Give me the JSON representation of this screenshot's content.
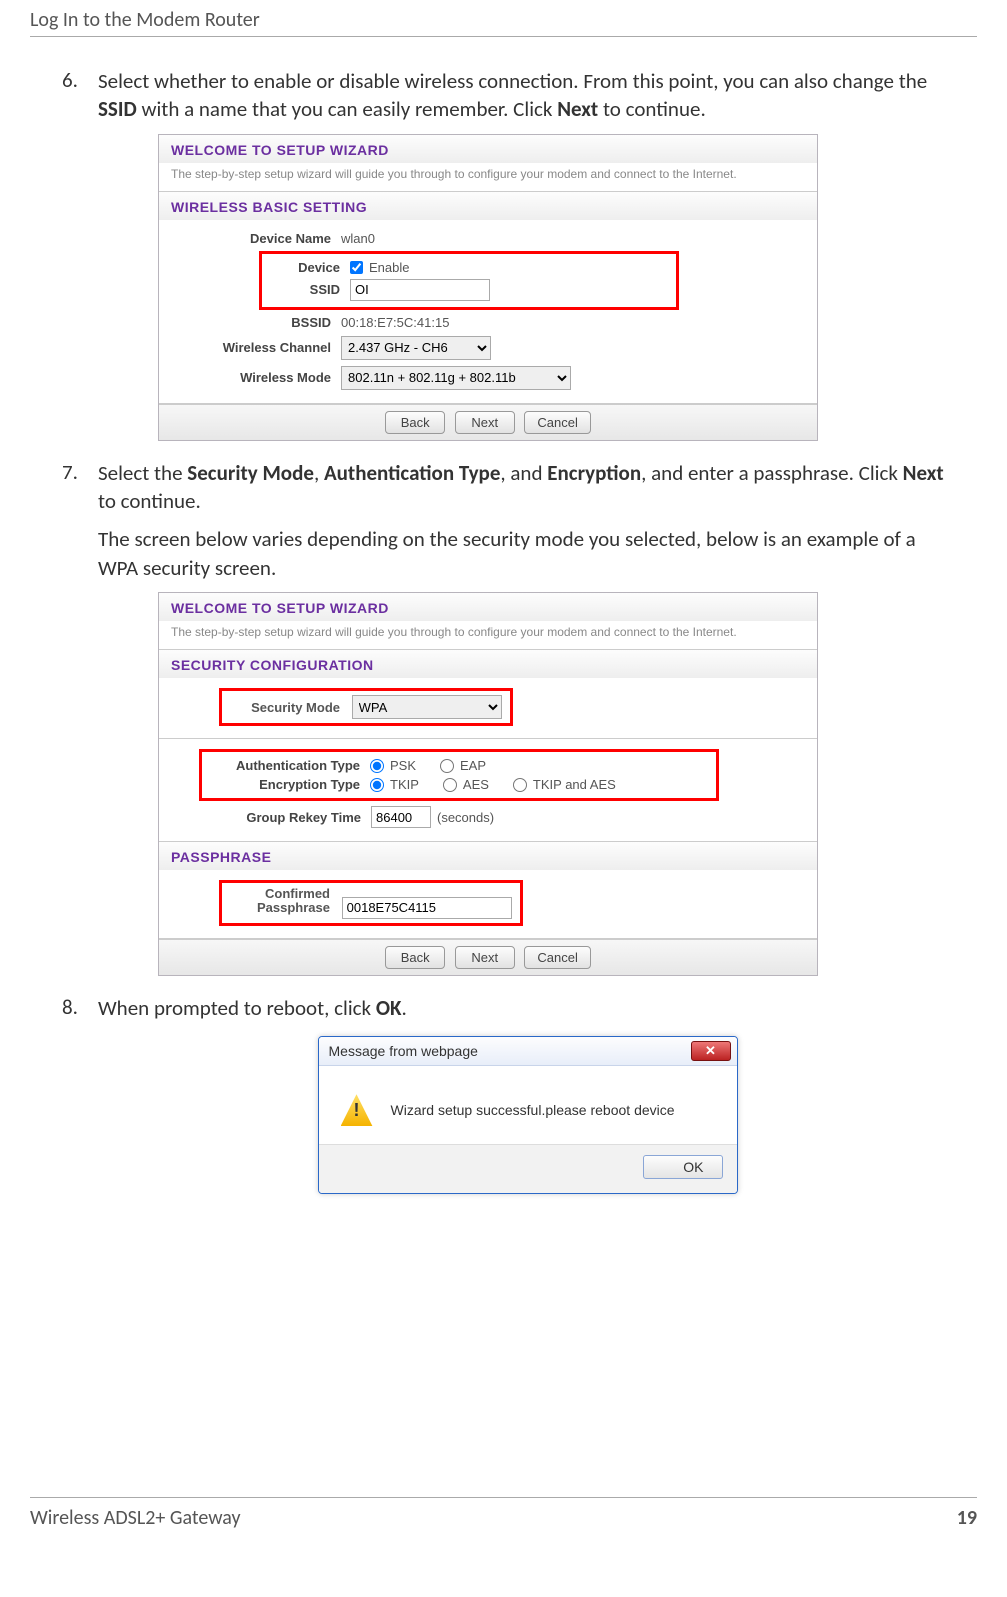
{
  "header": {
    "title": "Log In to the Modem Router"
  },
  "steps": {
    "s6": {
      "num": "6.",
      "text_pre": "Select whether to enable or disable wireless connection. From this point, you can also change the ",
      "ssid": "SSID",
      "text_mid": " with a name that you can easily remember. Click ",
      "next": "Next",
      "text_post": " to continue."
    },
    "s7": {
      "num": "7.",
      "l1_pre": "Select the ",
      "secmode": "Security Mode",
      "sep1": ", ",
      "authtype": "Authentication Type",
      "sep2": ", and ",
      "enc": "Encryption",
      "l1_mid": ", and enter a passphrase. Click ",
      "next": "Next",
      "l1_post": " to continue.",
      "l2": "The screen below varies depending on the security mode you selected, below is an example of a WPA security screen."
    },
    "s8": {
      "num": "8.",
      "pre": "When prompted to reboot, click ",
      "ok": "OK",
      "post": "."
    }
  },
  "wizard_title": "WELCOME TO SETUP WIZARD",
  "wizard_desc": "The step-by-step setup wizard will guide you through to configure your modem and connect to the Internet.",
  "wiz1": {
    "sec_head": "WIRELESS BASIC SETTING",
    "rows": {
      "devname_lbl": "Device Name",
      "devname_val": "wlan0",
      "device_lbl": "Device",
      "device_chk": "Enable",
      "ssid_lbl": "SSID",
      "ssid_val": "OI",
      "bssid_lbl": "BSSID",
      "bssid_val": "00:18:E7:5C:41:15",
      "chan_lbl": "Wireless Channel",
      "chan_val": "2.437 GHz - CH6",
      "mode_lbl": "Wireless Mode",
      "mode_val": "802.11n + 802.11g + 802.11b"
    }
  },
  "wiz2": {
    "sec1_head": "SECURITY CONFIGURATION",
    "rows": {
      "secmode_lbl": "Security Mode",
      "secmode_val": "WPA",
      "auth_lbl": "Authentication Type",
      "auth_psk": "PSK",
      "auth_eap": "EAP",
      "enc_lbl": "Encryption Type",
      "enc_tkip": "TKIP",
      "enc_aes": "AES",
      "enc_both": "TKIP and AES",
      "rekey_lbl": "Group Rekey Time",
      "rekey_val": "86400",
      "rekey_unit": "(seconds)"
    },
    "sec2_head": "PASSPHRASE",
    "pass_lbl": "Confirmed Passphrase",
    "pass_val": "0018E75C4115"
  },
  "buttons": {
    "back": "Back",
    "next": "Next",
    "cancel": "Cancel"
  },
  "dialog": {
    "title": "Message from webpage",
    "msg": "Wizard setup successful.please reboot device",
    "ok": "OK",
    "close": "✕"
  },
  "footer": {
    "left": "Wireless ADSL2+ Gateway",
    "right": "19"
  }
}
